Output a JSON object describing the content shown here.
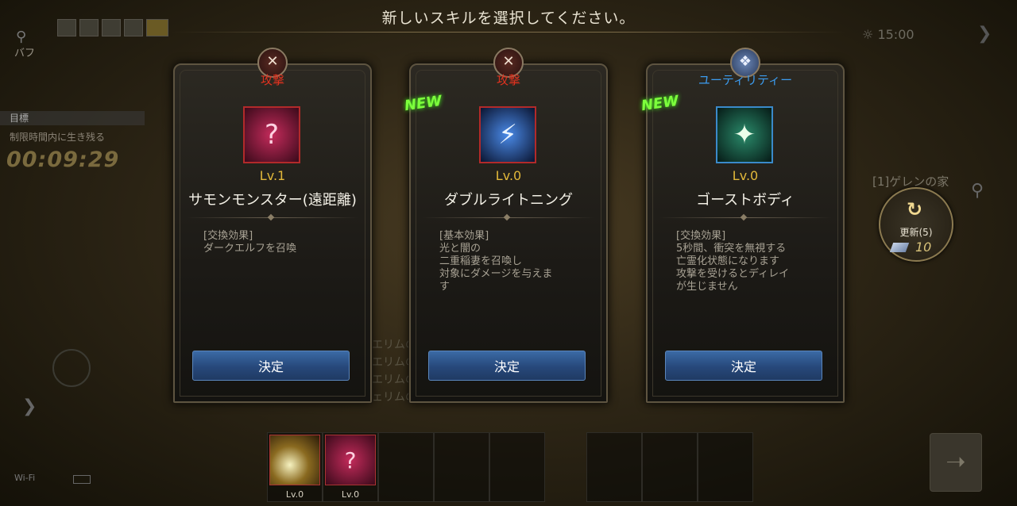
{
  "header": {
    "title": "新しいスキルを選択してください。"
  },
  "hud_left": {
    "buff_label": "バフ",
    "goal_label": "目標",
    "goal_desc": "制限時間内に生き残る",
    "timer": "00:09:29",
    "wifi": "Wi-Fi"
  },
  "hud_right": {
    "time": "15:00",
    "location": "[1]ゲレンの家",
    "refresh_label": "更新(5)",
    "refresh_cost": "10"
  },
  "cards": [
    {
      "category": "攻撃",
      "new": "",
      "level": "Lv.1",
      "name": "サモンモンスター(遠距離)",
      "desc": "[交換効果]\nダークエルフを召喚",
      "button": "決定",
      "icon": "summon-skill-icon"
    },
    {
      "category": "攻撃",
      "new": "NEW",
      "level": "Lv.0",
      "name": "ダブルライトニング",
      "desc": "[基本効果]\n光と闇の\n二重稲妻を召喚し\n対象にダメージを与えま\nす",
      "button": "決定",
      "icon": "lightning-skill-icon"
    },
    {
      "category": "ユーティリティー",
      "new": "NEW",
      "level": "Lv.0",
      "name": "ゴーストボディ",
      "desc": "[交換効果]\n5秒間、衝突を無視する\n亡霊化状態になります\n攻撃を受けるとディレイ\nが生じません",
      "button": "決定",
      "icon": "ghost-skill-icon"
    }
  ],
  "slots": [
    {
      "level": "Lv.0",
      "icon": "fireball-icon"
    },
    {
      "level": "Lv.0",
      "icon": "summon-skill-icon"
    }
  ],
  "colors": {
    "attack": "#e0321f",
    "utility": "#3c9cf0",
    "level": "#e2b83a",
    "new": "#7dff3c",
    "button": "#27487a"
  }
}
